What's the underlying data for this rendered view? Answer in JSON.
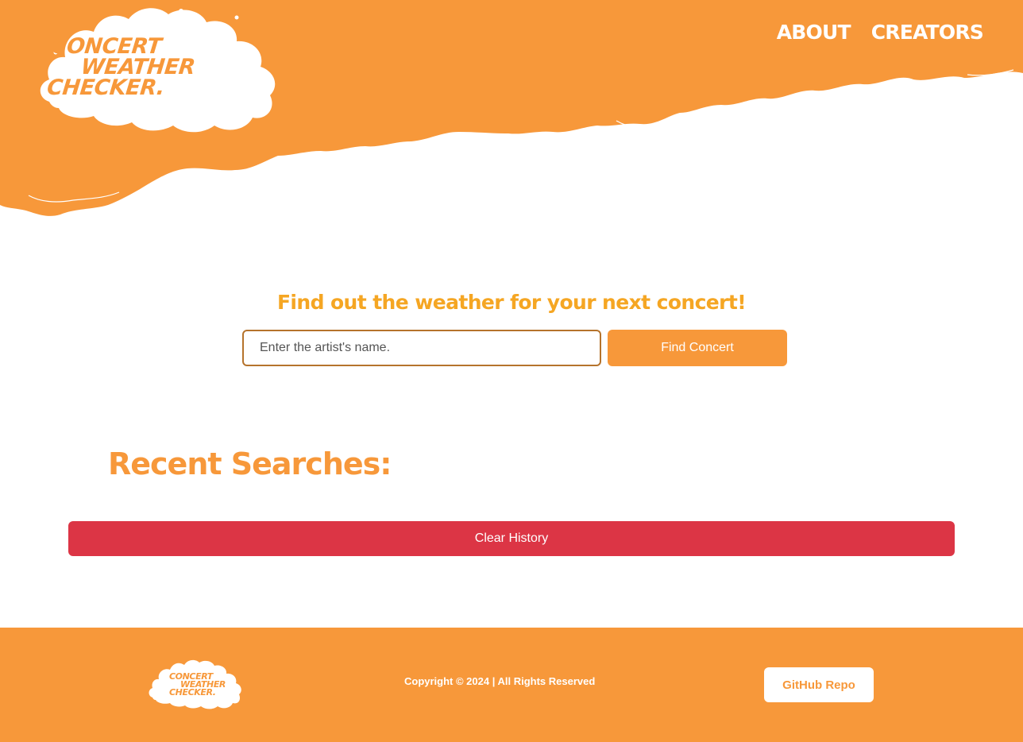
{
  "brand": {
    "logo_line1": "CONCERT",
    "logo_line2": "WEATHER",
    "logo_line3": "CHECKER.",
    "primary_color": "#f7983a",
    "accent_text_color": "#f5a623",
    "danger_color": "#dc3545"
  },
  "nav": {
    "about_label": "ABOUT",
    "creators_label": "CREATORS"
  },
  "search": {
    "heading": "Find out the weather for your next concert!",
    "placeholder": "Enter the artist's name.",
    "value": "",
    "button_label": "Find Concert"
  },
  "recent": {
    "title": "Recent Searches:",
    "clear_label": "Clear History"
  },
  "footer": {
    "copyright": "Copyright © 2024 | All Rights Reserved",
    "github_label": "GitHub Repo"
  }
}
